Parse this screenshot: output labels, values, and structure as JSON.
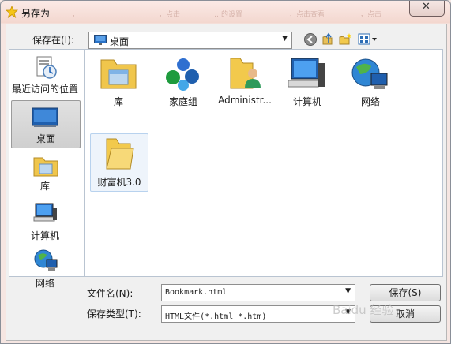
{
  "window": {
    "title": "另存为",
    "ghost_tabs": [
      "，",
      "，点击",
      "…的设置",
      "，点击查看",
      "，点击"
    ]
  },
  "toolbar": {
    "save_in_label": "保存在(I):",
    "location": "桌面"
  },
  "places": [
    {
      "label": "最近访问的位置",
      "icon": "recent-places-icon"
    },
    {
      "label": "桌面",
      "icon": "desktop-icon",
      "selected": true
    },
    {
      "label": "库",
      "icon": "library-icon"
    },
    {
      "label": "计算机",
      "icon": "computer-icon"
    },
    {
      "label": "网络",
      "icon": "network-icon"
    }
  ],
  "files": [
    {
      "label": "库",
      "icon": "library-icon"
    },
    {
      "label": "家庭组",
      "icon": "homegroup-icon"
    },
    {
      "label": "Administr...",
      "icon": "user-folder-icon"
    },
    {
      "label": "计算机",
      "icon": "computer-icon"
    },
    {
      "label": "网络",
      "icon": "network-icon"
    },
    {
      "label": "财富机3.0",
      "icon": "folder-icon",
      "selected": true
    }
  ],
  "form": {
    "filename_label": "文件名(N):",
    "filename_value": "Bookmark.html",
    "filetype_label": "保存类型(T):",
    "filetype_value": "HTML文件(*.html *.htm)",
    "save_button": "保存(S)",
    "cancel_button": "取消"
  },
  "watermark": "Baidu 经验",
  "colors": {
    "selection": "#d8d8d8",
    "folder": "#f2c94c",
    "accent": "#1e63b8"
  }
}
